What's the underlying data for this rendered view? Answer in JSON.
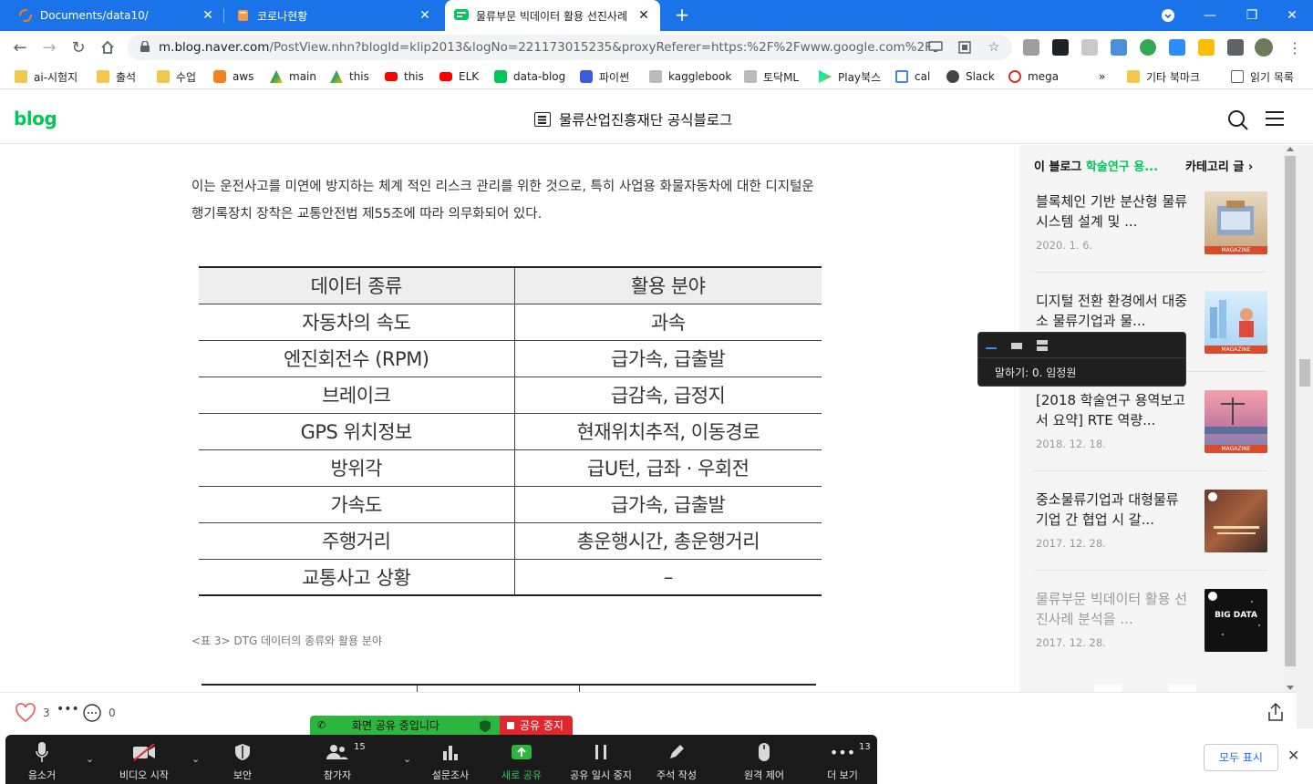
{
  "browser": {
    "tabs": [
      {
        "title": "Documents/data10/",
        "active": false
      },
      {
        "title": "코로나현황",
        "active": false
      },
      {
        "title": "물류부문 빅데이터 활용 선진사례",
        "active": true
      }
    ],
    "url_host": "m.blog.naver.com",
    "url_path": "/PostView.nhn?blogId=klip2013&logNo=221173015235&proxyReferer=https:%2F%2Fwww.google.com%2F",
    "bookmarks": [
      "ai-시험지",
      "출석",
      "수업",
      "aws",
      "main",
      "this",
      "this",
      "ELK",
      "data-blog",
      "파이썬",
      "kagglebook",
      "토닥ML",
      "Play북스",
      "cal",
      "Slack",
      "mega"
    ],
    "bookmarks_more": "»",
    "other_bookmarks": "기타 북마크",
    "reading_list": "읽기 목록"
  },
  "header": {
    "logo": "blog",
    "title": "물류산업진흥재단 공식블로그"
  },
  "article": {
    "paragraph": "이는 운전사고를 미연에 방지하는 체계 적인 리스크 관리를 위한 것으로, 특히 사업용 화물자동차에 대한 디지털운행기록장치 장착은 교통안전법 제55조에 따라 의무화되어 있다.",
    "table": {
      "headers": [
        "데이터 종류",
        "활용 분야"
      ],
      "rows": [
        [
          "자동차의 속도",
          "과속"
        ],
        [
          "엔진회전수 (RPM)",
          "급가속, 급출발"
        ],
        [
          "브레이크",
          "급감속, 급정지"
        ],
        [
          "GPS 위치정보",
          "현재위치추적, 이동경로"
        ],
        [
          "방위각",
          "급U턴, 급좌 · 우회전"
        ],
        [
          "가속도",
          "급가속, 급출발"
        ],
        [
          "주행거리",
          "총운행시간, 총운행거리"
        ],
        [
          "교통사고 상황",
          "–"
        ]
      ]
    },
    "caption": "<표 3> DTG 데이터의 종류와 활용 분야"
  },
  "sidebar": {
    "head_prefix": "이 블로그",
    "head_category": "학술연구 용...",
    "head_right": "카테고리 글",
    "posts": [
      {
        "title": "블록체인 기반 분산형 물류 시스템 설계 및 ...",
        "date": "2020. 1. 6.",
        "thumb": "magazine-blockchain"
      },
      {
        "title": "디지털 전환 환경에서 대중소 물류기업과 물...",
        "date": "",
        "thumb": "magazine-digital"
      },
      {
        "title": "[2018 학술연구 용역보고서 요약] RTE 역량...",
        "date": "2018. 12. 18.",
        "thumb": "magazine-port"
      },
      {
        "title": "중소물류기업과 대형물류기업 간 협업 시 갈...",
        "date": "2017. 12. 28.",
        "thumb": "collab"
      },
      {
        "title": "물류부문 빅데이터 활용 선진사례 분석을 ...",
        "date": "2017. 12. 28.",
        "thumb": "bigdata",
        "current": true
      }
    ],
    "magazine_label": "MAGAZINE",
    "bigdata_label": "BIG DATA"
  },
  "bottom": {
    "likes": "3",
    "comments": "0"
  },
  "speaking_popup": {
    "text": "말하기: 0. 임정원"
  },
  "zoom": {
    "sharing_text": "화면 공유 중입니다",
    "stop_share": "공유 중지",
    "buttons": {
      "audio": "음소거",
      "video": "비디오 시작",
      "security": "보안",
      "participants": "참가자",
      "participants_count": "15",
      "polls": "설문조사",
      "new_share": "새로 공유",
      "pause_share": "공유 일시 중지",
      "annotate": "주석 작성",
      "remote": "원격 제어",
      "more": "더 보기",
      "more_count": "13"
    },
    "show_all": "모두 표시"
  },
  "colors": {
    "chrome_blue": "#1a73e8",
    "naver_green": "#03c75a",
    "zoom_green": "#2db63d",
    "zoom_red": "#e0272d"
  }
}
